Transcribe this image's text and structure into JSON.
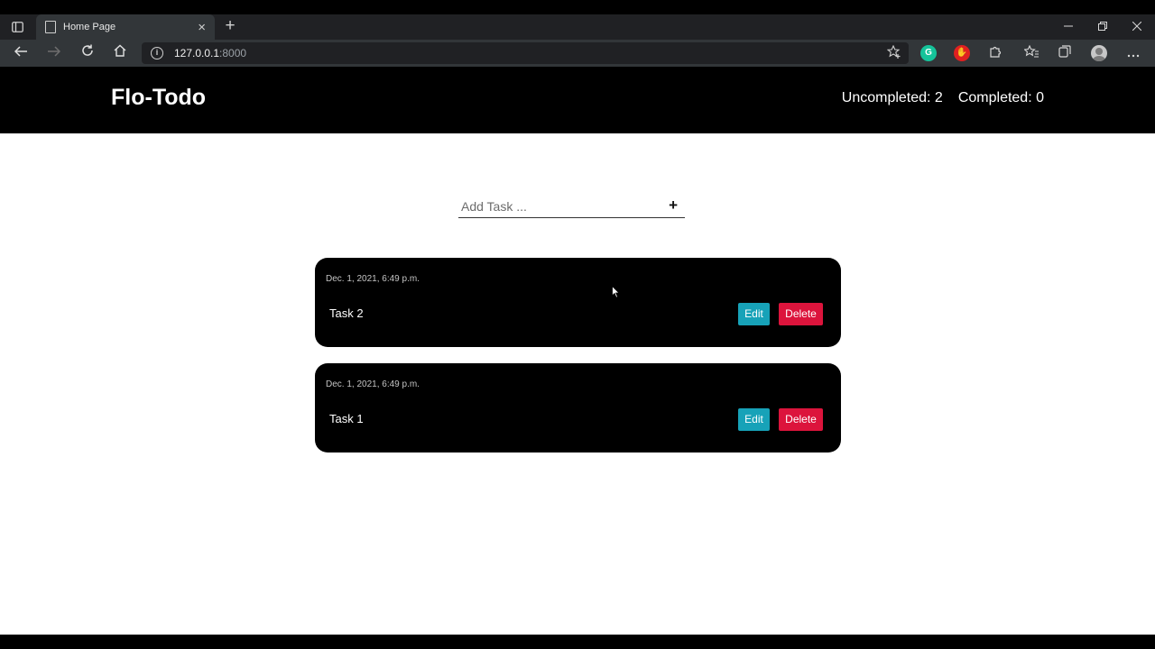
{
  "browser": {
    "tab_title": "Home Page",
    "tab_close": "×",
    "new_tab": "+",
    "url_host": "127.0.0.1",
    "url_port": ":8000"
  },
  "app": {
    "brand": "Flo-Todo",
    "uncompleted_label": "Uncompleted: 2",
    "completed_label": "Completed: 0"
  },
  "add_task": {
    "placeholder": "Add Task ...",
    "submit_icon": "plus-icon",
    "submit_glyph": "+"
  },
  "tasks": [
    {
      "date": "Dec. 1, 2021, 6:49 p.m.",
      "title": "Task 2",
      "edit_label": "Edit",
      "delete_label": "Delete"
    },
    {
      "date": "Dec. 1, 2021, 6:49 p.m.",
      "title": "Task 1",
      "edit_label": "Edit",
      "delete_label": "Delete"
    }
  ],
  "colors": {
    "edit_button": "#17a2b8",
    "delete_button": "#dc143c",
    "navbar": "#000000",
    "card": "#000000"
  }
}
